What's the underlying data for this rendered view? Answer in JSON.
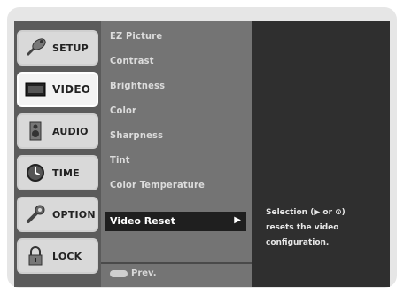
{
  "tabs": [
    {
      "label": "SETUP",
      "icon": "satellite-dish-icon",
      "active": false
    },
    {
      "label": "VIDEO",
      "icon": "monitor-icon",
      "active": true
    },
    {
      "label": "AUDIO",
      "icon": "speaker-icon",
      "active": false
    },
    {
      "label": "TIME",
      "icon": "clock-icon",
      "active": false
    },
    {
      "label": "OPTION",
      "icon": "wrench-icon",
      "active": false
    },
    {
      "label": "LOCK",
      "icon": "lock-icon",
      "active": false
    }
  ],
  "menu": {
    "items": [
      "EZ Picture",
      "Contrast",
      "Brightness",
      "Color",
      "Sharpness",
      "Tint",
      "Color Temperature"
    ],
    "selected": "Video Reset",
    "selected_arrow": "▶",
    "prev_label": "Prev."
  },
  "help": {
    "line1": "Selection (▶ or ⊙)",
    "line2": "resets the video",
    "line3": "configuration."
  }
}
